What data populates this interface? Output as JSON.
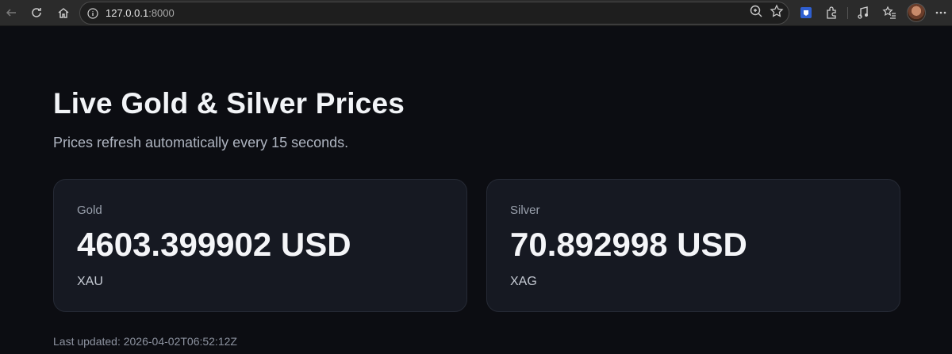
{
  "browser": {
    "url_host": "127.0.0.1",
    "url_port": ":8000"
  },
  "page": {
    "title": "Live Gold & Silver Prices",
    "subtitle": "Prices refresh automatically every 15 seconds.",
    "cards": [
      {
        "name": "Gold",
        "price": "4603.399902 USD",
        "code": "XAU"
      },
      {
        "name": "Silver",
        "price": "70.892998 USD",
        "code": "XAG"
      }
    ],
    "last_updated": "Last updated: 2026-04-02T06:52:12Z"
  }
}
